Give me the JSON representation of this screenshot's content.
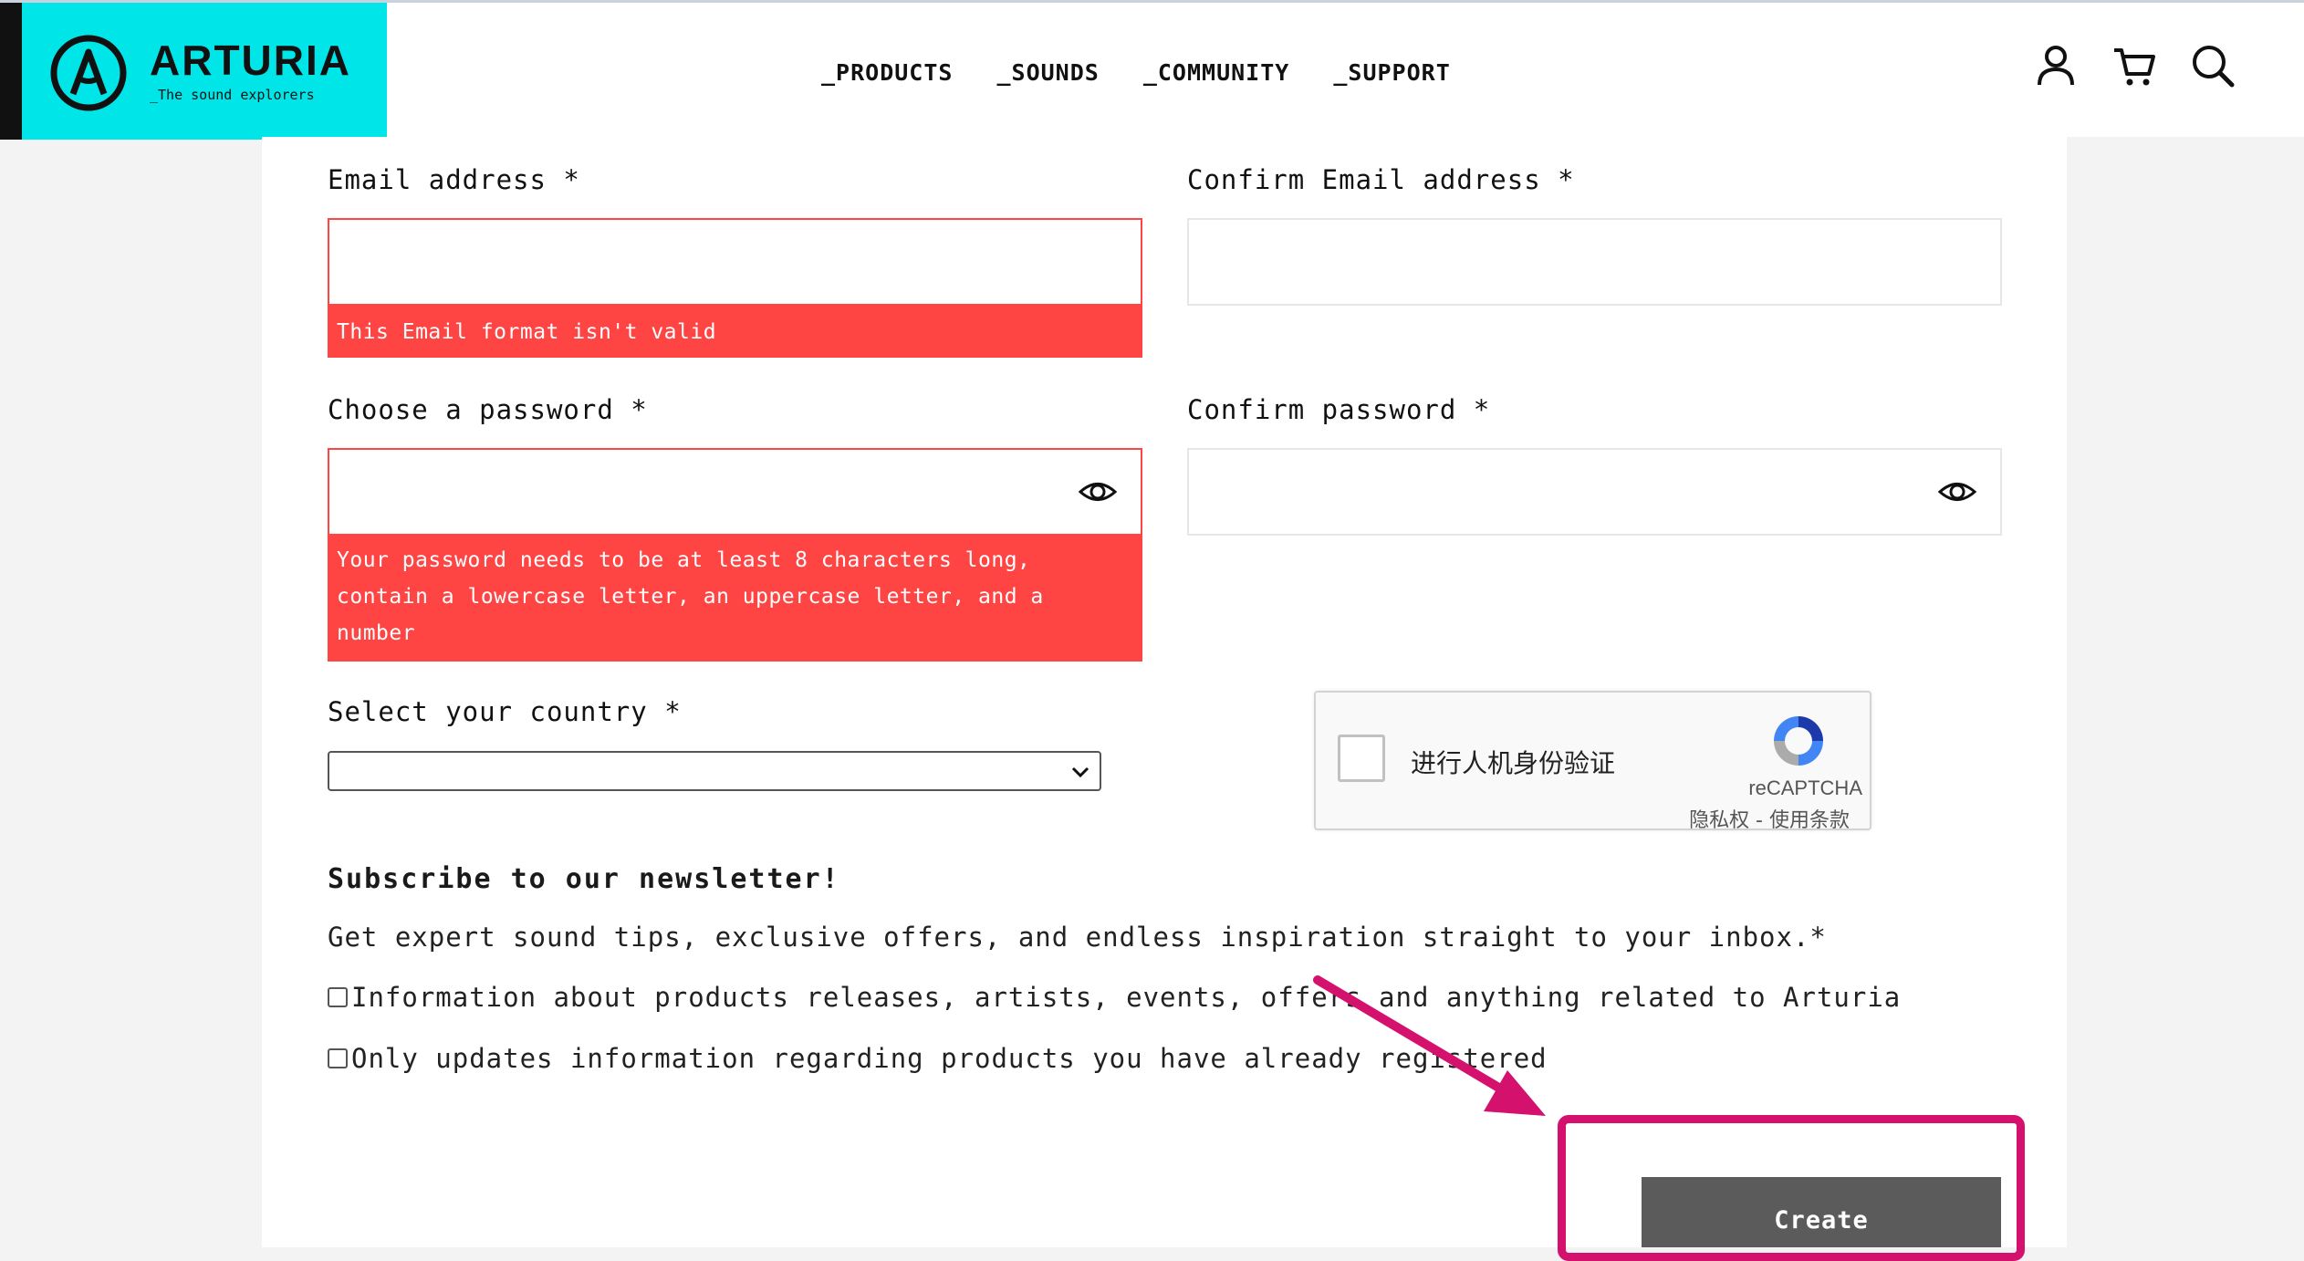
{
  "brand": {
    "name": "ARTURIA",
    "tagline": "_The sound explorers",
    "color": "#00e5e8"
  },
  "nav": {
    "items": [
      "_PRODUCTS",
      "_SOUNDS",
      "_COMMUNITY",
      "_SUPPORT"
    ],
    "icons": [
      "user-icon",
      "cart-icon",
      "search-icon"
    ]
  },
  "form": {
    "email_label": "Email address *",
    "email_value": "",
    "email_error": "This Email format isn't valid",
    "confirm_email_label": "Confirm Email address *",
    "confirm_email_value": "",
    "password_label": "Choose a password *",
    "password_error": "Your password needs to be at least 8 characters long, contain a lowercase letter, an uppercase letter, and a number",
    "confirm_password_label": "Confirm password *",
    "country_label": "Select your country *",
    "country_value": ""
  },
  "recaptcha": {
    "label": "进行人机身份验证",
    "brand": "reCAPTCHA",
    "links": "隐私权 - 使用条款"
  },
  "newsletter": {
    "title": "Subscribe to our newsletter!",
    "description": "Get expert sound tips, exclusive offers, and endless inspiration straight to your inbox.*",
    "option1": "Information about products releases, artists, events, offers and anything related to Arturia",
    "option2": "Only updates information regarding products you have already registered"
  },
  "actions": {
    "create_label": "Create"
  },
  "colors": {
    "error": "#ff4444",
    "highlight": "#d5116e",
    "button": "#5b5b5b"
  }
}
